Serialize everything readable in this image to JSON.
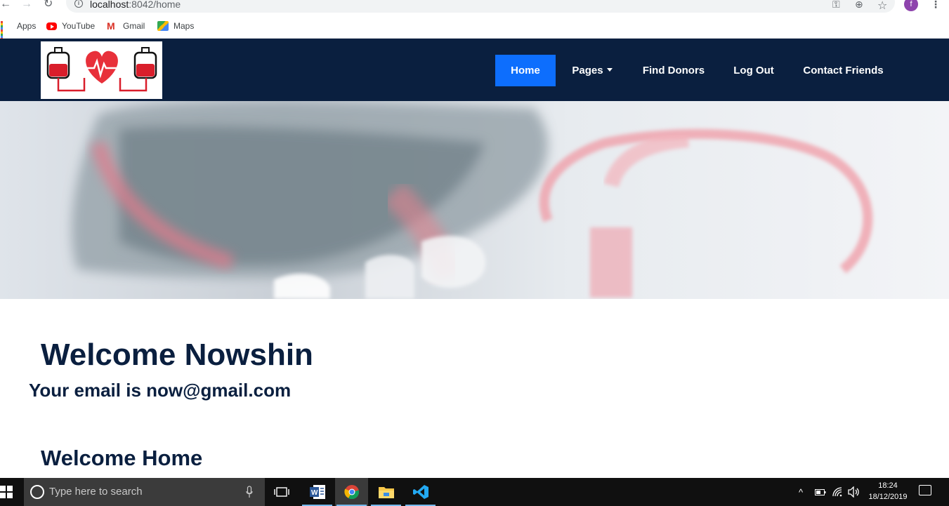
{
  "browser": {
    "url_host": "localhost",
    "url_rest": ":8042/home",
    "profile_initial": "f",
    "bookmarks": [
      {
        "label": "Apps",
        "icon": "apps-grid-icon"
      },
      {
        "label": "YouTube",
        "icon": "youtube-icon"
      },
      {
        "label": "Gmail",
        "icon": "gmail-icon"
      },
      {
        "label": "Maps",
        "icon": "maps-icon"
      }
    ]
  },
  "site": {
    "brand_colors": {
      "nav_bg": "#0a1f3f",
      "active": "#0d6efd",
      "heart": "#e8303a"
    },
    "nav": {
      "home": "Home",
      "pages": "Pages",
      "find_donors": "Find Donors",
      "log_out": "Log Out",
      "contact_friends": "Contact Friends"
    },
    "welcome_title": "Welcome Nowshin",
    "email_line": "Your email is now@gmail.com",
    "home_heading": "Welcome Home"
  },
  "taskbar": {
    "search_placeholder": "Type here to search",
    "time": "18:24",
    "date": "18/12/2019"
  }
}
